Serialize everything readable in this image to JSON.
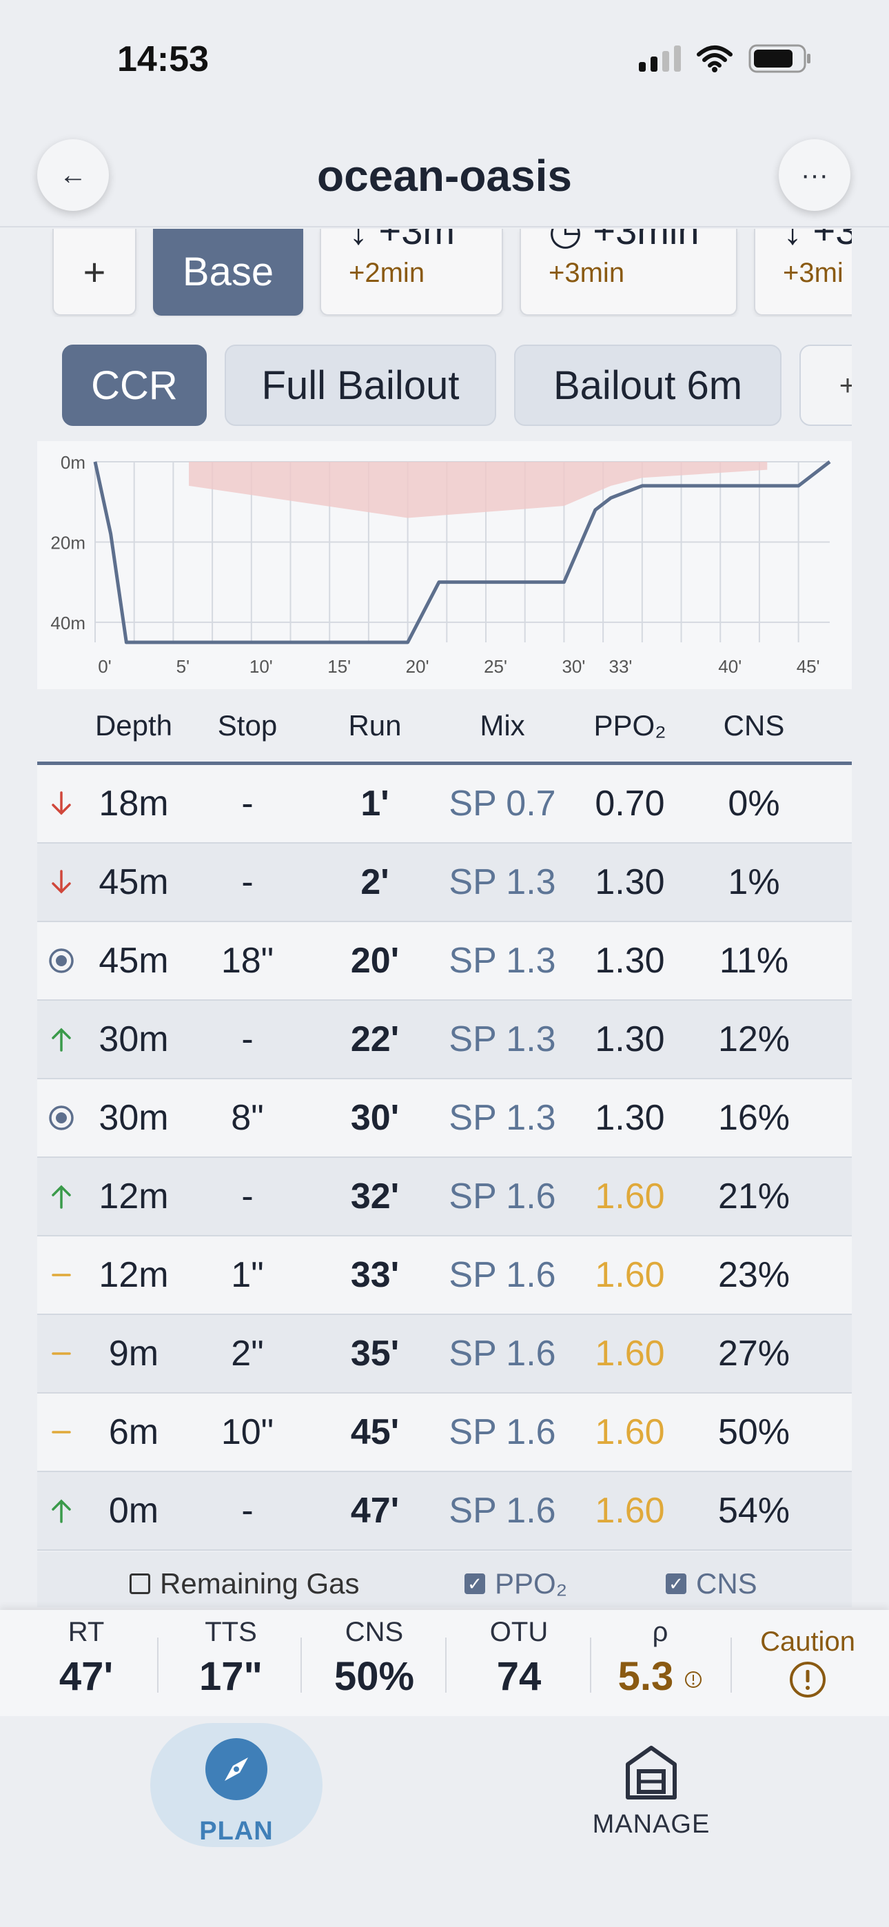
{
  "status": {
    "time": "14:53"
  },
  "header": {
    "title": "ocean-oasis",
    "back_icon": "←",
    "more_icon": "···"
  },
  "plans": [
    {
      "type": "add",
      "label": "+"
    },
    {
      "type": "active",
      "label": "Base"
    },
    {
      "line1": "↓ +3m",
      "line2": "+2min"
    },
    {
      "line1": "◷ +3min",
      "line2": "+3min"
    },
    {
      "line1": "↓ +3",
      "line2": "+3mi"
    }
  ],
  "modes": [
    {
      "label": "CCR",
      "active": true
    },
    {
      "label": "Full Bailout"
    },
    {
      "label": "Bailout 6m"
    },
    {
      "label": "+"
    }
  ],
  "chart_data": {
    "type": "area",
    "x_ticks": [
      "0'",
      "5'",
      "10'",
      "15'",
      "20'",
      "25'",
      "30'",
      "33'",
      "40'",
      "45'"
    ],
    "x_tick_values": [
      0,
      5,
      10,
      15,
      20,
      25,
      30,
      33,
      40,
      45
    ],
    "y_ticks": [
      "0m",
      "20m",
      "40m"
    ],
    "y_tick_values": [
      0,
      20,
      40
    ],
    "xlim": [
      0,
      47
    ],
    "ylim": [
      0,
      45
    ],
    "grid": true,
    "depth_profile": {
      "x": [
        0,
        1,
        2,
        20,
        22,
        30,
        32,
        33,
        35,
        45,
        47
      ],
      "y": [
        0,
        18,
        45,
        45,
        30,
        30,
        12,
        9,
        6,
        6,
        0
      ]
    },
    "ceiling": {
      "x": [
        6,
        6,
        20,
        30,
        33,
        35,
        43,
        43
      ],
      "y": [
        0,
        6,
        14,
        11,
        6,
        4,
        2,
        0
      ]
    },
    "colors": {
      "profile": "#5d6f8d",
      "ceiling": "#f0c8c8"
    }
  },
  "table": {
    "headers": [
      "Depth",
      "Stop",
      "Run",
      "Mix",
      "PPO₂",
      "CNS"
    ],
    "rows": [
      {
        "icon": "down",
        "depth": "18m",
        "stop": "-",
        "run": "1'",
        "mix": "SP 0.7",
        "ppo2": "0.70",
        "cns": "0%",
        "warn": false
      },
      {
        "icon": "down",
        "depth": "45m",
        "stop": "-",
        "run": "2'",
        "mix": "SP 1.3",
        "ppo2": "1.30",
        "cns": "1%",
        "warn": false
      },
      {
        "icon": "stop",
        "depth": "45m",
        "stop": "18\"",
        "run": "20'",
        "mix": "SP 1.3",
        "ppo2": "1.30",
        "cns": "11%",
        "warn": false
      },
      {
        "icon": "up",
        "depth": "30m",
        "stop": "-",
        "run": "22'",
        "mix": "SP 1.3",
        "ppo2": "1.30",
        "cns": "12%",
        "warn": false
      },
      {
        "icon": "stop",
        "depth": "30m",
        "stop": "8\"",
        "run": "30'",
        "mix": "SP 1.3",
        "ppo2": "1.30",
        "cns": "16%",
        "warn": false
      },
      {
        "icon": "up",
        "depth": "12m",
        "stop": "-",
        "run": "32'",
        "mix": "SP 1.6",
        "ppo2": "1.60",
        "cns": "21%",
        "warn": true
      },
      {
        "icon": "deco",
        "depth": "12m",
        "stop": "1\"",
        "run": "33'",
        "mix": "SP 1.6",
        "ppo2": "1.60",
        "cns": "23%",
        "warn": true
      },
      {
        "icon": "deco",
        "depth": "9m",
        "stop": "2\"",
        "run": "35'",
        "mix": "SP 1.6",
        "ppo2": "1.60",
        "cns": "27%",
        "warn": true
      },
      {
        "icon": "deco",
        "depth": "6m",
        "stop": "10\"",
        "run": "45'",
        "mix": "SP 1.6",
        "ppo2": "1.60",
        "cns": "50%",
        "warn": true
      },
      {
        "icon": "up",
        "depth": "0m",
        "stop": "-",
        "run": "47'",
        "mix": "SP 1.6",
        "ppo2": "1.60",
        "cns": "54%",
        "warn": true
      }
    ]
  },
  "toggles": {
    "remaining_gas": {
      "label": "Remaining Gas",
      "checked": false
    },
    "ppo2": {
      "label": "PPO₂",
      "checked": true
    },
    "cns": {
      "label": "CNS",
      "checked": true
    }
  },
  "stats": {
    "rt": {
      "label": "RT",
      "value": "47'"
    },
    "tts": {
      "label": "TTS",
      "value": "17\""
    },
    "cns": {
      "label": "CNS",
      "value": "50%"
    },
    "otu": {
      "label": "OTU",
      "value": "74"
    },
    "rho": {
      "label": "ρ",
      "value": "5.3"
    },
    "caution": {
      "label": "Caution"
    }
  },
  "nav": {
    "plan": "PLAN",
    "manage": "MANAGE"
  },
  "colors": {
    "accent": "#5d6f8d",
    "nav_accent": "#3f7fb8",
    "down": "#d0473b",
    "up": "#3a9a4a",
    "deco": "#e0a93a",
    "caution": "#8a5a12"
  }
}
